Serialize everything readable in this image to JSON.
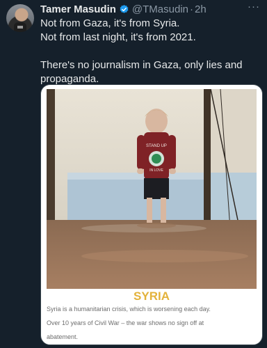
{
  "author": {
    "name": "Tamer Masudin",
    "handle": "@TMasudin",
    "time": "2h",
    "verified": true
  },
  "icons": {
    "avatar": "user-avatar",
    "verified": "verified-badge-icon",
    "more": "more-options-icon"
  },
  "colors": {
    "background": "#15202b",
    "accent": "#1d9bf0",
    "caption_title": "#e3b23a"
  },
  "tweet": {
    "lines": [
      "Not from Gaza, it's from Syria.",
      "Not from last night, it's from 2021.",
      "There's no journalism in Gaza, only lies and propaganda."
    ]
  },
  "media": {
    "shirt_text_top": "STAND UP",
    "shirt_text_bottom": "IN LOVE",
    "caption_title": "SYRIA",
    "caption_lines": [
      "Syria is a humanitarian crisis, which is worsening each day.",
      "Over 10 years of Civil War – the war shows no sign off at",
      "abatement."
    ]
  }
}
